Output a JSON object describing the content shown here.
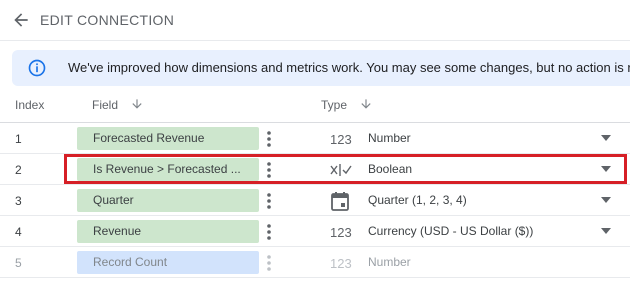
{
  "header": {
    "title": "EDIT CONNECTION",
    "back_icon": "arrow-back-icon"
  },
  "banner": {
    "icon": "info-icon",
    "text": "We've improved how dimensions and metrics work. You may see some changes, but no action is requ"
  },
  "columns": {
    "index": "Index",
    "field": "Field",
    "type": "Type"
  },
  "rows": [
    {
      "index": "1",
      "field": "Forecasted Revenue",
      "type_icon": "123",
      "type": "Number",
      "kind": "dimension",
      "has_dropdown": true
    },
    {
      "index": "2",
      "field": "Is Revenue > Forecasted ...",
      "type_icon": "✕|✓",
      "type": "Boolean",
      "kind": "dimension",
      "has_dropdown": true,
      "highlighted": true
    },
    {
      "index": "3",
      "field": "Quarter",
      "type_icon": "calendar-icon",
      "type": "Quarter (1, 2, 3, 4)",
      "kind": "dimension",
      "has_dropdown": true
    },
    {
      "index": "4",
      "field": "Revenue",
      "type_icon": "123",
      "type": "Currency (USD - US Dollar ($))",
      "kind": "dimension",
      "has_dropdown": true
    },
    {
      "index": "5",
      "field": "Record Count",
      "type_icon": "123",
      "type": "Number",
      "kind": "metric",
      "has_dropdown": false
    }
  ],
  "colors": {
    "dimension_chip": "#cde6cd",
    "metric_chip": "#d2e3fc",
    "banner_bg": "#e8f0fe",
    "highlight_border": "#d61f26"
  }
}
